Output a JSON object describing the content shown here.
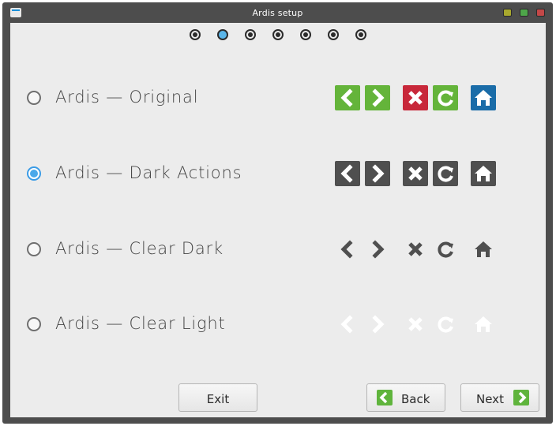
{
  "window": {
    "title": "Ardis setup"
  },
  "wizard": {
    "step_count": 7,
    "current_step": 2
  },
  "themes": [
    {
      "label": "Ardis — Original",
      "selected": false,
      "style": "original"
    },
    {
      "label": "Ardis — Dark Actions",
      "selected": true,
      "style": "dark"
    },
    {
      "label": "Ardis — Clear Dark",
      "selected": false,
      "style": "clear-dark"
    },
    {
      "label": "Ardis — Clear Light",
      "selected": false,
      "style": "clear-light"
    }
  ],
  "preview_icons": [
    "back-icon",
    "forward-icon",
    "stop-icon",
    "reload-icon",
    "home-icon"
  ],
  "colors": {
    "green": "#64b43a",
    "red": "#c8283a",
    "blue": "#1a6ca8",
    "dark": "#4f4f4f",
    "clear_dark": "#4f4f4f",
    "clear_light": "#ffffff",
    "accent": "#4aa8ea"
  },
  "buttons": {
    "exit": "Exit",
    "back": "Back",
    "next": "Next"
  }
}
